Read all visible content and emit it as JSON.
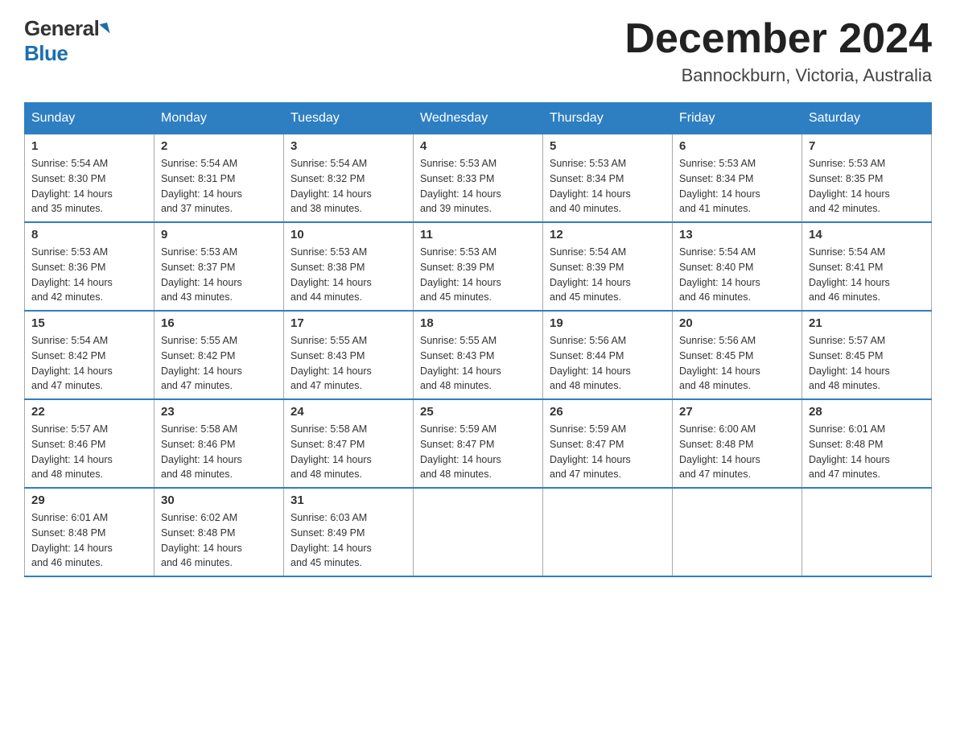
{
  "logo": {
    "general": "General",
    "blue": "Blue"
  },
  "title": "December 2024",
  "location": "Bannockburn, Victoria, Australia",
  "days_of_week": [
    "Sunday",
    "Monday",
    "Tuesday",
    "Wednesday",
    "Thursday",
    "Friday",
    "Saturday"
  ],
  "weeks": [
    [
      {
        "day": "1",
        "sunrise": "5:54 AM",
        "sunset": "8:30 PM",
        "daylight": "14 hours and 35 minutes."
      },
      {
        "day": "2",
        "sunrise": "5:54 AM",
        "sunset": "8:31 PM",
        "daylight": "14 hours and 37 minutes."
      },
      {
        "day": "3",
        "sunrise": "5:54 AM",
        "sunset": "8:32 PM",
        "daylight": "14 hours and 38 minutes."
      },
      {
        "day": "4",
        "sunrise": "5:53 AM",
        "sunset": "8:33 PM",
        "daylight": "14 hours and 39 minutes."
      },
      {
        "day": "5",
        "sunrise": "5:53 AM",
        "sunset": "8:34 PM",
        "daylight": "14 hours and 40 minutes."
      },
      {
        "day": "6",
        "sunrise": "5:53 AM",
        "sunset": "8:34 PM",
        "daylight": "14 hours and 41 minutes."
      },
      {
        "day": "7",
        "sunrise": "5:53 AM",
        "sunset": "8:35 PM",
        "daylight": "14 hours and 42 minutes."
      }
    ],
    [
      {
        "day": "8",
        "sunrise": "5:53 AM",
        "sunset": "8:36 PM",
        "daylight": "14 hours and 42 minutes."
      },
      {
        "day": "9",
        "sunrise": "5:53 AM",
        "sunset": "8:37 PM",
        "daylight": "14 hours and 43 minutes."
      },
      {
        "day": "10",
        "sunrise": "5:53 AM",
        "sunset": "8:38 PM",
        "daylight": "14 hours and 44 minutes."
      },
      {
        "day": "11",
        "sunrise": "5:53 AM",
        "sunset": "8:39 PM",
        "daylight": "14 hours and 45 minutes."
      },
      {
        "day": "12",
        "sunrise": "5:54 AM",
        "sunset": "8:39 PM",
        "daylight": "14 hours and 45 minutes."
      },
      {
        "day": "13",
        "sunrise": "5:54 AM",
        "sunset": "8:40 PM",
        "daylight": "14 hours and 46 minutes."
      },
      {
        "day": "14",
        "sunrise": "5:54 AM",
        "sunset": "8:41 PM",
        "daylight": "14 hours and 46 minutes."
      }
    ],
    [
      {
        "day": "15",
        "sunrise": "5:54 AM",
        "sunset": "8:42 PM",
        "daylight": "14 hours and 47 minutes."
      },
      {
        "day": "16",
        "sunrise": "5:55 AM",
        "sunset": "8:42 PM",
        "daylight": "14 hours and 47 minutes."
      },
      {
        "day": "17",
        "sunrise": "5:55 AM",
        "sunset": "8:43 PM",
        "daylight": "14 hours and 47 minutes."
      },
      {
        "day": "18",
        "sunrise": "5:55 AM",
        "sunset": "8:43 PM",
        "daylight": "14 hours and 48 minutes."
      },
      {
        "day": "19",
        "sunrise": "5:56 AM",
        "sunset": "8:44 PM",
        "daylight": "14 hours and 48 minutes."
      },
      {
        "day": "20",
        "sunrise": "5:56 AM",
        "sunset": "8:45 PM",
        "daylight": "14 hours and 48 minutes."
      },
      {
        "day": "21",
        "sunrise": "5:57 AM",
        "sunset": "8:45 PM",
        "daylight": "14 hours and 48 minutes."
      }
    ],
    [
      {
        "day": "22",
        "sunrise": "5:57 AM",
        "sunset": "8:46 PM",
        "daylight": "14 hours and 48 minutes."
      },
      {
        "day": "23",
        "sunrise": "5:58 AM",
        "sunset": "8:46 PM",
        "daylight": "14 hours and 48 minutes."
      },
      {
        "day": "24",
        "sunrise": "5:58 AM",
        "sunset": "8:47 PM",
        "daylight": "14 hours and 48 minutes."
      },
      {
        "day": "25",
        "sunrise": "5:59 AM",
        "sunset": "8:47 PM",
        "daylight": "14 hours and 48 minutes."
      },
      {
        "day": "26",
        "sunrise": "5:59 AM",
        "sunset": "8:47 PM",
        "daylight": "14 hours and 47 minutes."
      },
      {
        "day": "27",
        "sunrise": "6:00 AM",
        "sunset": "8:48 PM",
        "daylight": "14 hours and 47 minutes."
      },
      {
        "day": "28",
        "sunrise": "6:01 AM",
        "sunset": "8:48 PM",
        "daylight": "14 hours and 47 minutes."
      }
    ],
    [
      {
        "day": "29",
        "sunrise": "6:01 AM",
        "sunset": "8:48 PM",
        "daylight": "14 hours and 46 minutes."
      },
      {
        "day": "30",
        "sunrise": "6:02 AM",
        "sunset": "8:48 PM",
        "daylight": "14 hours and 46 minutes."
      },
      {
        "day": "31",
        "sunrise": "6:03 AM",
        "sunset": "8:49 PM",
        "daylight": "14 hours and 45 minutes."
      },
      null,
      null,
      null,
      null
    ]
  ],
  "labels": {
    "sunrise": "Sunrise:",
    "sunset": "Sunset:",
    "daylight": "Daylight:"
  }
}
